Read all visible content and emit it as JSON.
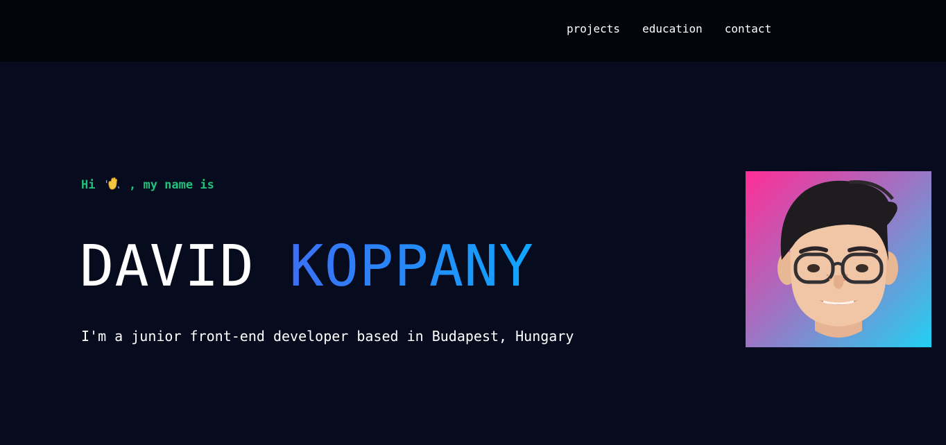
{
  "nav": {
    "items": [
      {
        "label": "projects"
      },
      {
        "label": "education"
      },
      {
        "label": "contact"
      }
    ]
  },
  "hero": {
    "greeting_prefix": "Hi",
    "greeting_suffix": ", my name is",
    "wave_icon": "waving-hand-icon",
    "first_name": "DAVID",
    "last_name": "KOPPANY",
    "tagline": "I'm a junior front-end developer based in Budapest, Hungary"
  },
  "colors": {
    "page_background": "#070b1e",
    "nav_background": "#03050d",
    "greeting": "#22c07a",
    "name_gradient_start": "#3b6ff5",
    "name_gradient_end": "#10a6ff",
    "avatar_gradient": [
      "#ff2d96",
      "#a46fc1",
      "#22d0f2"
    ]
  }
}
